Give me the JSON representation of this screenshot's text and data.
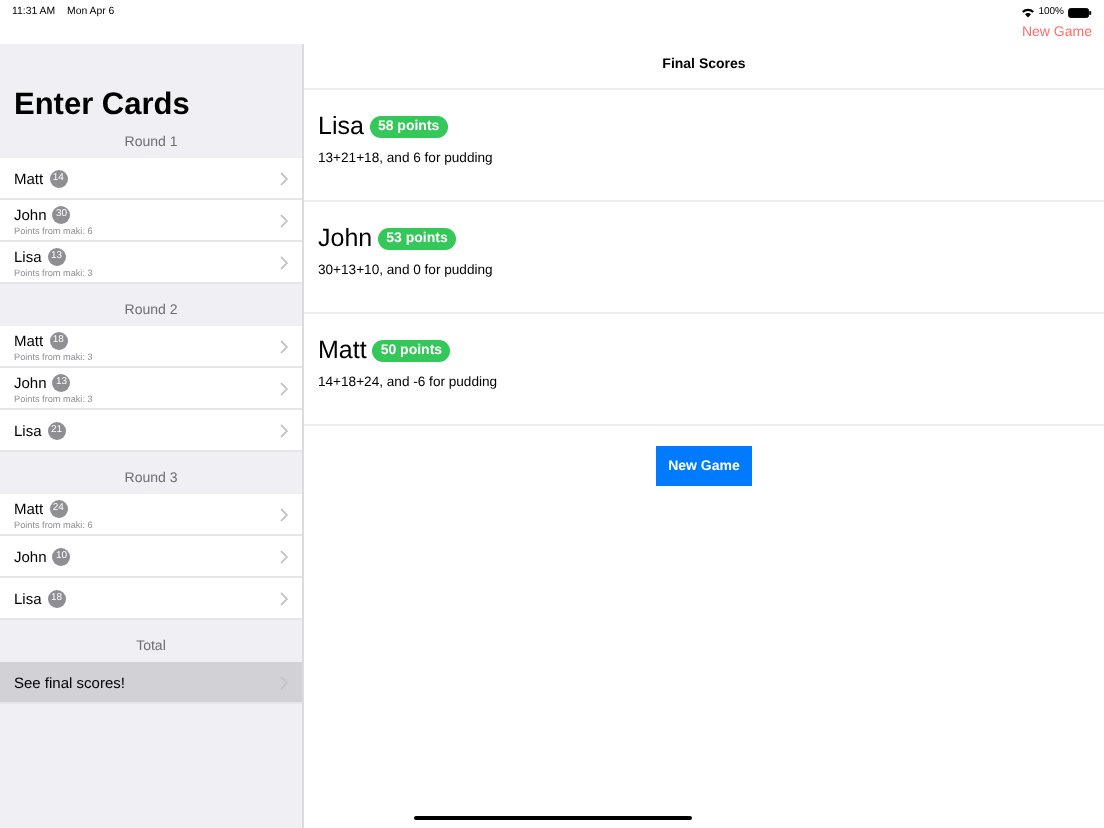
{
  "status_bar": {
    "time": "11:31 AM",
    "date": "Mon Apr 6",
    "battery": "100%"
  },
  "sidebar": {
    "title": "Enter Cards",
    "sections": [
      {
        "header": "Round 1",
        "rows": [
          {
            "name": "Matt",
            "score": "14"
          },
          {
            "name": "John",
            "score": "30",
            "note": "Points from maki: 6"
          },
          {
            "name": "Lisa",
            "score": "13",
            "note": "Points from maki: 3"
          }
        ]
      },
      {
        "header": "Round 2",
        "rows": [
          {
            "name": "Matt",
            "score": "18",
            "note": "Points from maki: 3"
          },
          {
            "name": "John",
            "score": "13",
            "note": "Points from maki: 3"
          },
          {
            "name": "Lisa",
            "score": "21"
          }
        ]
      },
      {
        "header": "Round 3",
        "rows": [
          {
            "name": "Matt",
            "score": "24",
            "note": "Points from maki: 6"
          },
          {
            "name": "John",
            "score": "10"
          },
          {
            "name": "Lisa",
            "score": "18"
          }
        ]
      }
    ],
    "total": {
      "header": "Total",
      "items": [
        {
          "label": "See final scores!",
          "selected": true
        }
      ]
    }
  },
  "main": {
    "nav_button": "New Game",
    "title": "Final Scores",
    "results": [
      {
        "name": "Lisa",
        "points": "58 points",
        "breakdown": "13+21+18, and 6 for pudding"
      },
      {
        "name": "John",
        "points": "53 points",
        "breakdown": "30+13+10, and 0 for pudding"
      },
      {
        "name": "Matt",
        "points": "50 points",
        "breakdown": "14+18+24, and -6 for pudding"
      }
    ],
    "button": "New Game"
  }
}
